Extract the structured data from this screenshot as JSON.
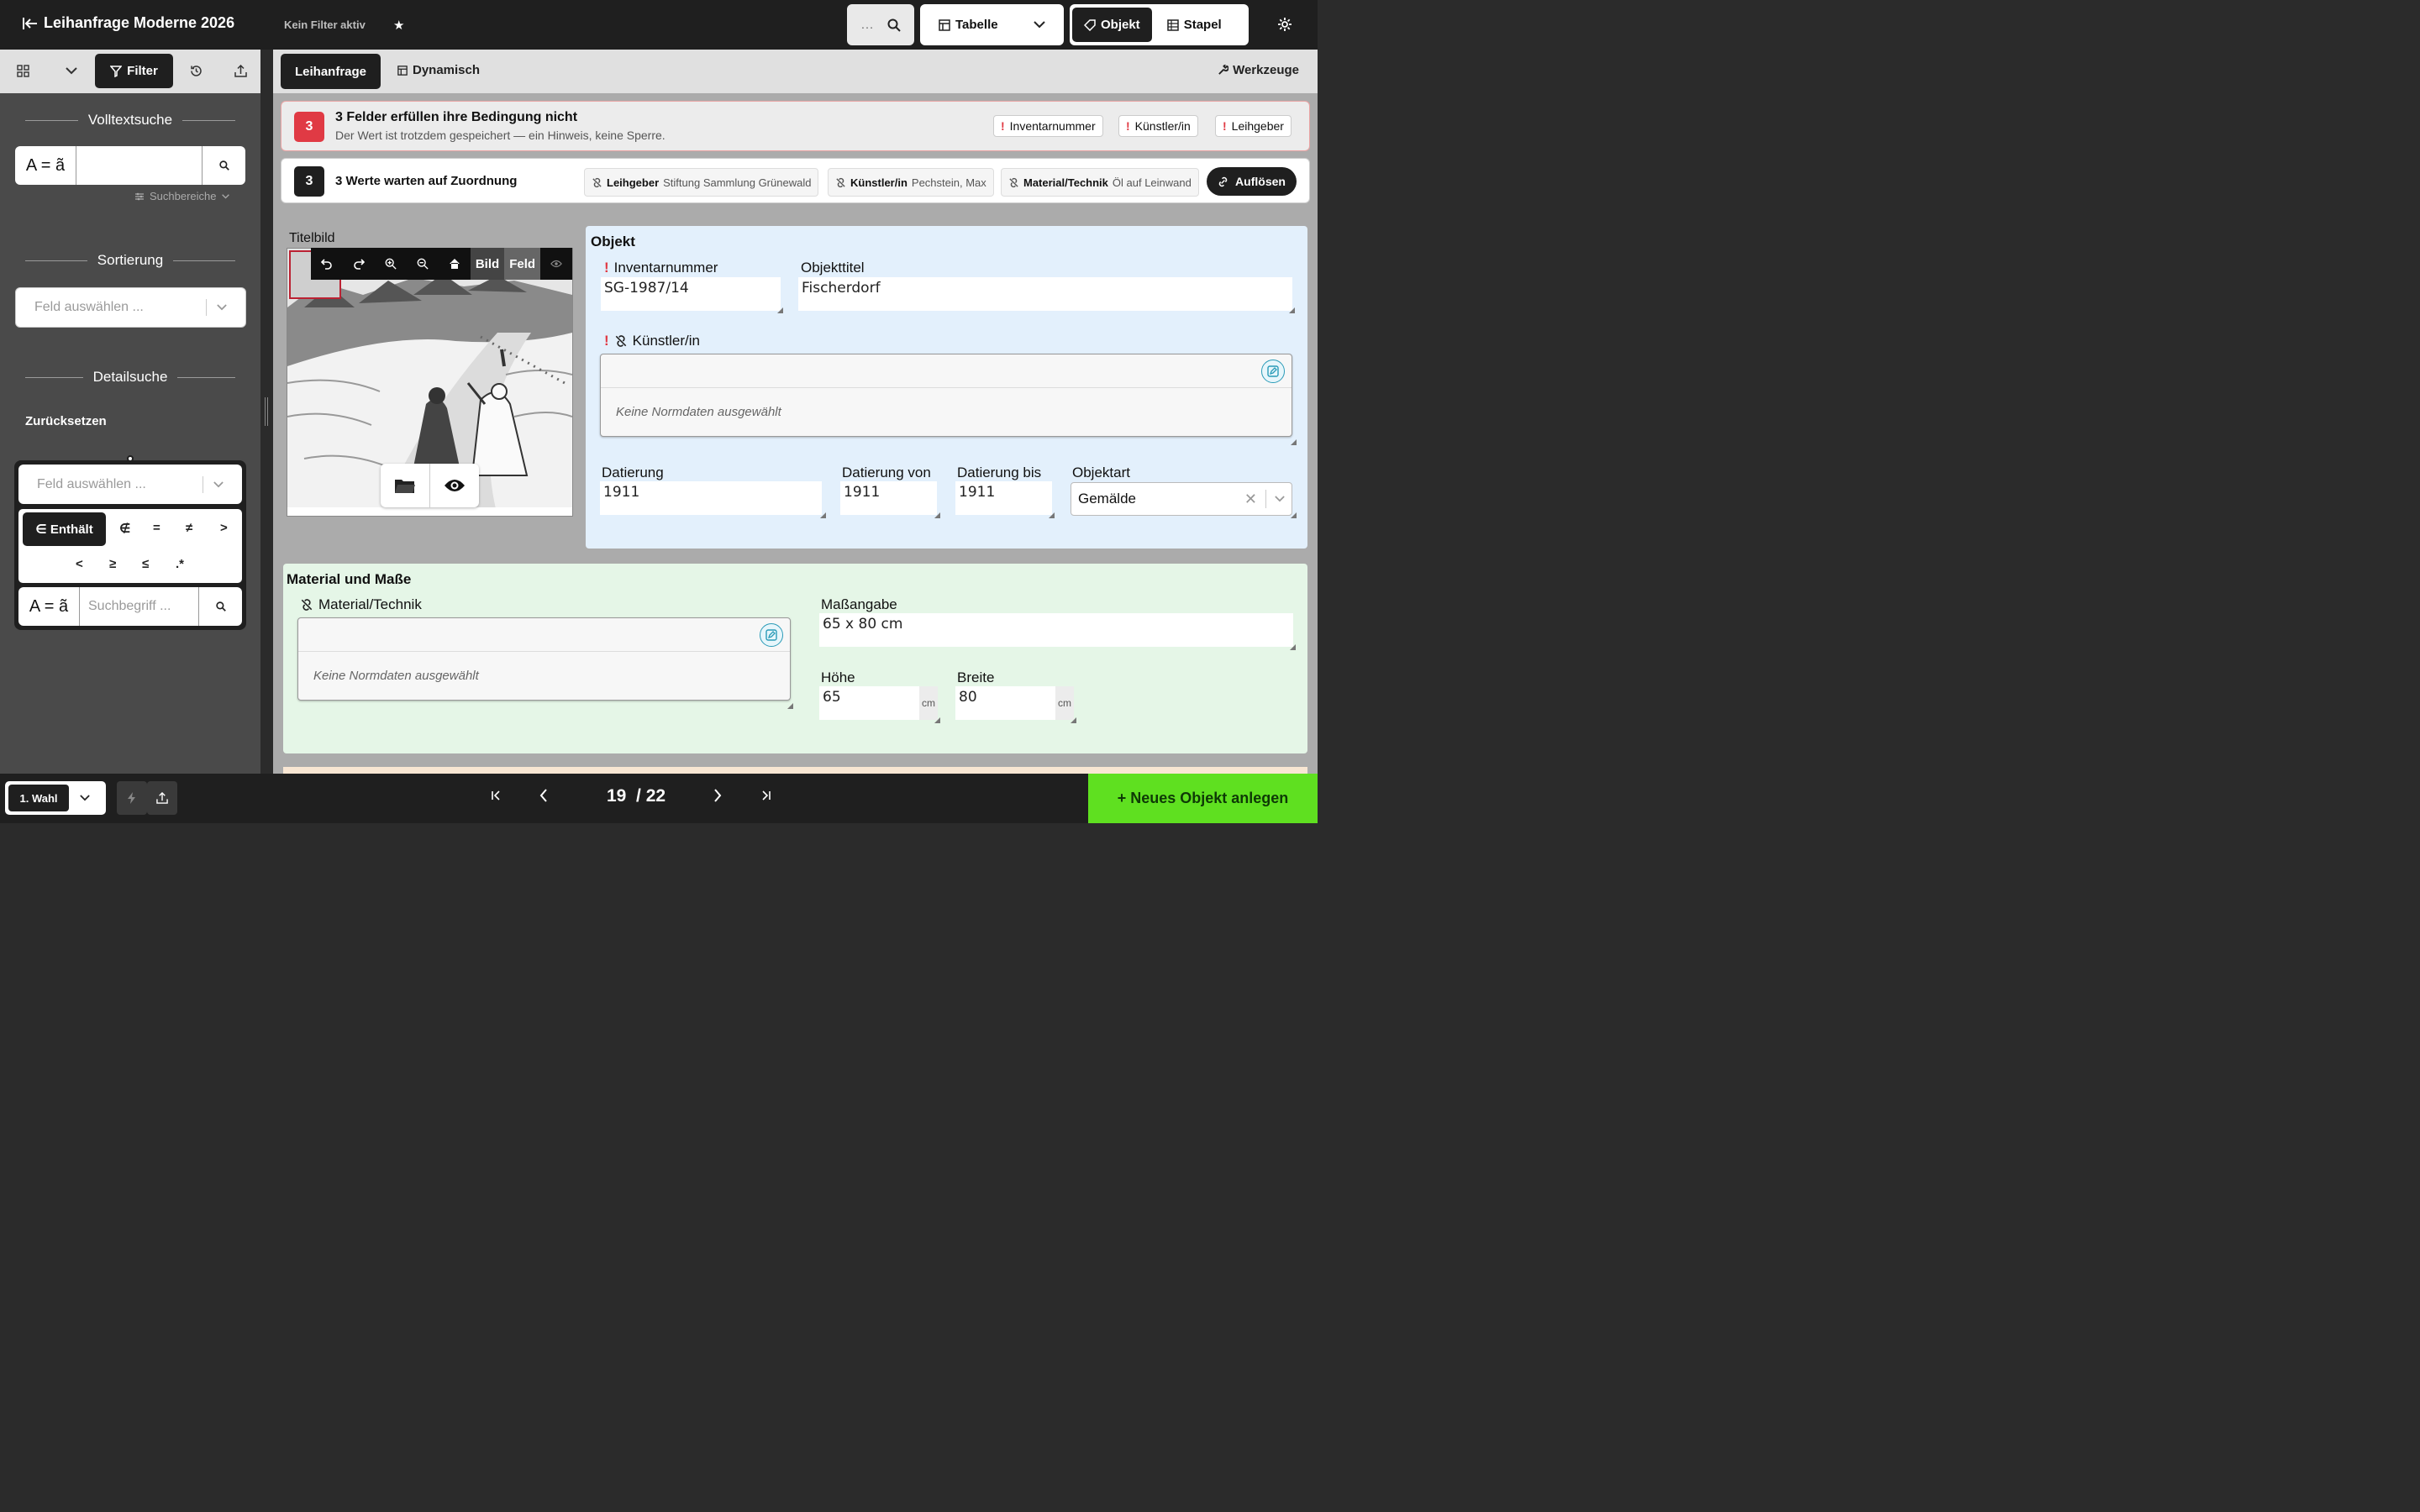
{
  "header": {
    "title": "Leihanfrage Moderne 2026",
    "filter_status": "Kein Filter aktiv",
    "quick_search_placeholder": "…",
    "view_select": "Tabelle",
    "mode_object": "Objekt",
    "mode_batch": "Stapel"
  },
  "sidebar": {
    "filter_label": "Filter",
    "fulltext_title": "Volltextsuche",
    "ae_toggle": "A = ã",
    "search_areas": "Suchbereiche",
    "sort_title": "Sortierung",
    "sort_placeholder": "Feld auswählen ...",
    "detail_title": "Detailsuche",
    "reset": "Zurücksetzen",
    "detail_field_placeholder": "Feld auswählen ...",
    "operators": [
      "∈ Enthält",
      "∉",
      "=",
      "≠",
      ">",
      "<",
      "≥",
      "≤",
      ".*"
    ],
    "search_term_placeholder": "Suchbegriff ..."
  },
  "tabs": {
    "leihanfrage": "Leihanfrage",
    "dynamisch": "Dynamisch",
    "tools": "Werkzeuge"
  },
  "alert": {
    "count": "3",
    "title": "3 Felder erfüllen ihre Bedingung nicht",
    "subtitle": "Der Wert ist trotzdem gespeichert — ein Hinweis, keine Sperre.",
    "chips": [
      "Inventarnummer",
      "Künstler/in",
      "Leihgeber"
    ]
  },
  "assign": {
    "count": "3",
    "title": "3 Werte warten auf Zuordnung",
    "chips": [
      {
        "field": "Leihgeber",
        "value": "Stiftung Sammlung Grünewald"
      },
      {
        "field": "Künstler/in",
        "value": "Pechstein, Max"
      },
      {
        "field": "Material/Technik",
        "value": "Öl auf Leinwand"
      }
    ],
    "resolve": "Auflösen"
  },
  "image": {
    "label": "Titelbild",
    "mode_image": "Bild",
    "mode_field": "Feld"
  },
  "object": {
    "title": "Objekt",
    "inv_label": "Inventarnummer",
    "inv_value": "SG-1987/14",
    "title_label": "Objekttitel",
    "title_value": "Fischerdorf",
    "artist_label": "Künstler/in",
    "no_norm": "Keine Normdaten ausgewählt",
    "dating_label": "Datierung",
    "dating_value": "1911",
    "dating_from_label": "Datierung von",
    "dating_from_value": "1911",
    "dating_to_label": "Datierung bis",
    "dating_to_value": "1911",
    "type_label": "Objektart",
    "type_value": "Gemälde"
  },
  "material": {
    "title": "Material und Maße",
    "tech_label": "Material/Technik",
    "no_norm": "Keine Normdaten ausgewählt",
    "dim_label": "Maßangabe",
    "dim_value": "65 x 80 cm",
    "height_label": "Höhe",
    "height_value": "65",
    "width_label": "Breite",
    "width_value": "80",
    "unit": "cm"
  },
  "footer": {
    "choice": "1. Wahl",
    "page_current": "19",
    "page_total": "/ 22",
    "new_object": "+ Neues Objekt anlegen"
  }
}
